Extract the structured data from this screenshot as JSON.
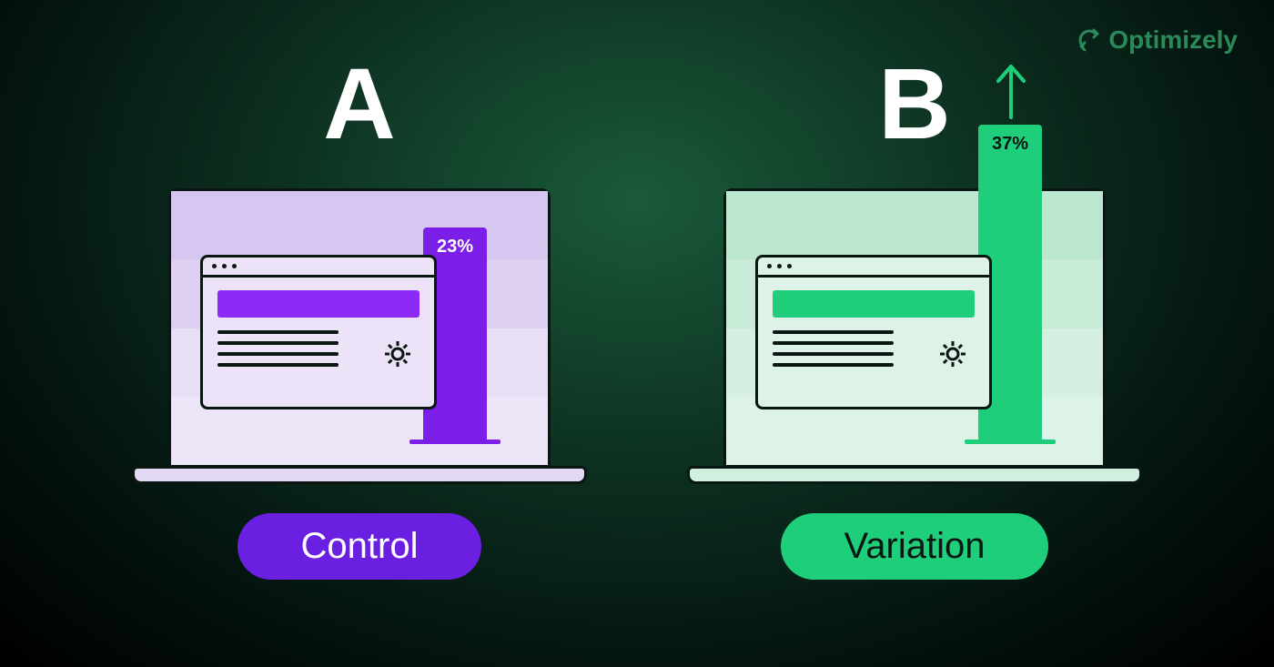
{
  "brand": {
    "name": "Optimizely"
  },
  "panels": {
    "a": {
      "letter": "A",
      "percent": "23%",
      "label": "Control"
    },
    "b": {
      "letter": "B",
      "percent": "37%",
      "label": "Variation"
    }
  },
  "colors": {
    "control_accent": "#6b1fe0",
    "variation_accent": "#1fce7a"
  }
}
